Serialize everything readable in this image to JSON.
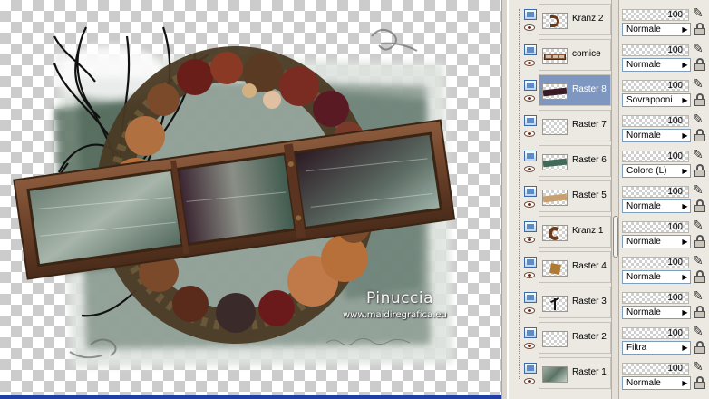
{
  "canvas": {
    "watermark_title": "Pinuccia",
    "watermark_url": "www.maidiregrafica.eu"
  },
  "layers": [
    {
      "name": "Kranz 2",
      "thumb": "brown-wreath-piece",
      "selected": false
    },
    {
      "name": "comice",
      "thumb": "frame-strip",
      "selected": false
    },
    {
      "name": "Raster 8",
      "thumb": "dark-strip",
      "selected": true
    },
    {
      "name": "Raster 7",
      "thumb": "empty",
      "selected": false
    },
    {
      "name": "Raster 6",
      "thumb": "green-strip",
      "selected": false
    },
    {
      "name": "Raster 5",
      "thumb": "tan-strip",
      "selected": false
    },
    {
      "name": "Kranz 1",
      "thumb": "wreath",
      "selected": false
    },
    {
      "name": "Raster 4",
      "thumb": "leaf-square",
      "selected": false
    },
    {
      "name": "Raster 3",
      "thumb": "tree",
      "selected": false
    },
    {
      "name": "Raster 2",
      "thumb": "empty",
      "selected": false
    },
    {
      "name": "Raster 1",
      "thumb": "green-background",
      "selected": false
    }
  ],
  "properties": [
    {
      "opacity": "100",
      "blend": "Normale"
    },
    {
      "opacity": "100",
      "blend": "Normale"
    },
    {
      "opacity": "100",
      "blend": "Sovrapponi"
    },
    {
      "opacity": "100",
      "blend": "Normale"
    },
    {
      "opacity": "100",
      "blend": "Colore (L)"
    },
    {
      "opacity": "100",
      "blend": "Normale"
    },
    {
      "opacity": "100",
      "blend": "Normale"
    },
    {
      "opacity": "100",
      "blend": "Normale"
    },
    {
      "opacity": "100",
      "blend": "Normale"
    },
    {
      "opacity": "100",
      "blend": "Filtra"
    },
    {
      "opacity": "100",
      "blend": "Normale"
    }
  ],
  "icons": {
    "visibility": "eye-icon",
    "layer_type": "raster-layer-icon",
    "edit": "brush-icon",
    "lock": "lock-icon",
    "dropdown": "triangle-right-icon"
  },
  "colors": {
    "selected_layer": "#7d97c1",
    "panel_bg": "#ece9e2",
    "status_bar": "#1f3fa6"
  }
}
